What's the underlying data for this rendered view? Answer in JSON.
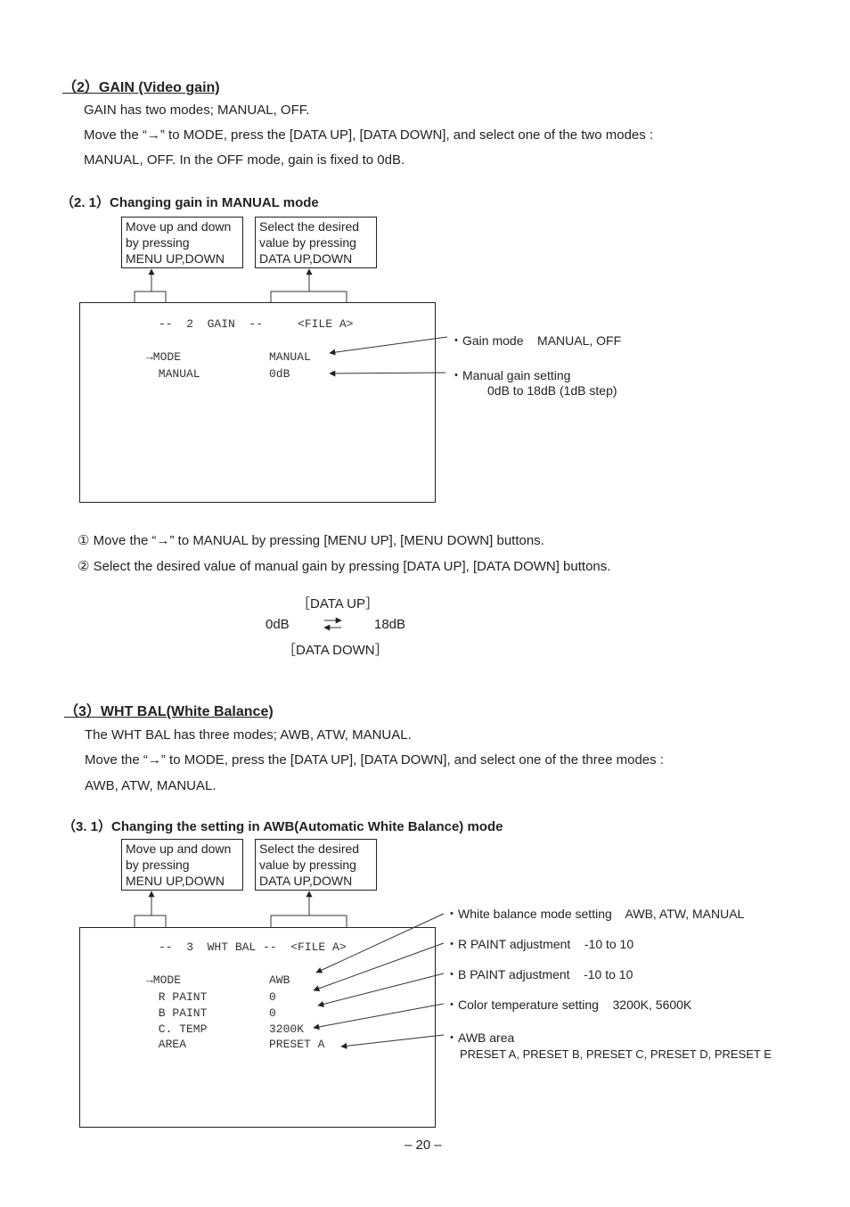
{
  "section_gain": {
    "heading": "（2）GAIN (Video gain)",
    "para1": "GAIN has two modes; MANUAL, OFF.",
    "para2": "Move the “→” to MODE, press the [DATA UP], [DATA DOWN], and select one of the two modes :",
    "para3": "MANUAL, OFF.  In the OFF mode, gain is fixed to 0dB.",
    "subheading": "（2. 1）Changing gain in MANUAL mode",
    "callout_menu": [
      "Move up and down",
      "by pressing",
      "MENU UP,DOWN"
    ],
    "callout_data": [
      "Select the desired",
      "value by pressing",
      "DATA UP,DOWN"
    ],
    "screen": {
      "title": "--  2  GAIN  --     <FILE A>",
      "rows": [
        {
          "label": "→MODE",
          "value": "MANUAL"
        },
        {
          "label": " MANUAL",
          "value": "0dB"
        }
      ]
    },
    "annotations": [
      {
        "text": "・Gain mode    MANUAL, OFF"
      },
      {
        "text": "・Manual gain setting",
        "sub": "0dB to 18dB (1dB step)"
      }
    ],
    "steps": [
      "① Move the “→” to MANUAL by pressing [MENU UP], [MENU DOWN] buttons.",
      "② Select the desired value of manual gain by pressing [DATA UP], [DATA DOWN] buttons."
    ],
    "range": {
      "up_label": "［DATA UP］",
      "down_label": "［DATA DOWN］",
      "min": "0dB",
      "max": "18dB"
    }
  },
  "section_wb": {
    "heading": "（3）WHT BAL(White Balance)",
    "para1": "The WHT BAL has three modes; AWB, ATW, MANUAL.",
    "para2": "Move the “→” to MODE, press the [DATA UP], [DATA DOWN], and select one of the three modes :",
    "para3": "AWB, ATW, MANUAL.",
    "subheading": "（3. 1）Changing the setting in AWB(Automatic White Balance) mode",
    "callout_menu": [
      "Move up and down",
      "by pressing",
      "MENU UP,DOWN"
    ],
    "callout_data": [
      "Select the desired",
      "value by pressing",
      "DATA UP,DOWN"
    ],
    "screen": {
      "title": "--  3  WHT BAL --  <FILE A>",
      "rows": [
        {
          "label": "→MODE",
          "value": "AWB"
        },
        {
          "label": " R PAINT",
          "value": "0"
        },
        {
          "label": " B PAINT",
          "value": "0"
        },
        {
          "label": " C. TEMP",
          "value": "3200K"
        },
        {
          "label": " AREA",
          "value": "PRESET A"
        }
      ]
    },
    "annotations": [
      {
        "text": "・White balance mode setting    AWB, ATW, MANUAL"
      },
      {
        "text": "・R PAINT adjustment    -10 to 10"
      },
      {
        "text": "・B PAINT adjustment    -10 to 10"
      },
      {
        "text": "・Color temperature setting    3200K, 5600K"
      },
      {
        "text": "・AWB area",
        "sub": "PRESET A, PRESET B, PRESET C, PRESET D, PRESET E"
      }
    ]
  },
  "footer": {
    "page_number": "– 20 –"
  }
}
